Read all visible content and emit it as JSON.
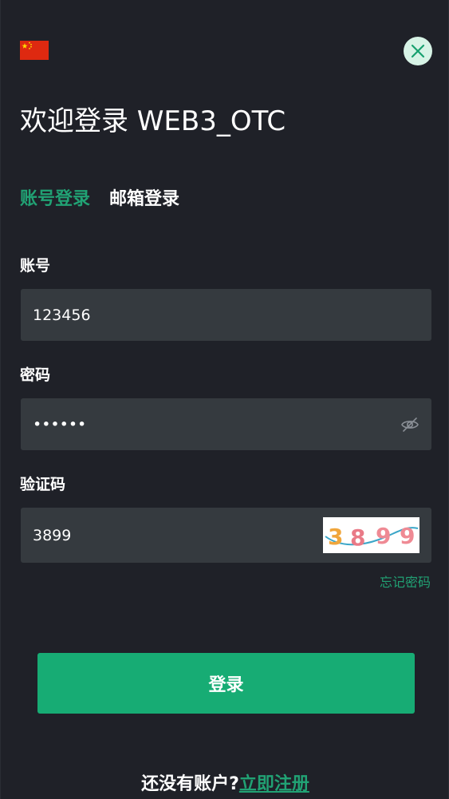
{
  "header": {
    "language_flag": "china-flag-icon",
    "close_icon": "close-icon"
  },
  "title": "欢迎登录 WEB3_OTC",
  "tabs": [
    {
      "label": "账号登录",
      "active": true
    },
    {
      "label": "邮箱登录",
      "active": false
    }
  ],
  "form": {
    "account": {
      "label": "账号",
      "value": "123456"
    },
    "password": {
      "label": "密码",
      "value": "••••••",
      "toggle_icon": "eye-slash-icon"
    },
    "captcha": {
      "label": "验证码",
      "value": "3899",
      "image_text": "3899"
    }
  },
  "forgot_password": "忘记密码",
  "login_button": "登录",
  "register": {
    "question": "还没有账户?",
    "link": "立即注册"
  },
  "colors": {
    "background": "#1f2128",
    "field": "#353a3f",
    "accent": "#21a274",
    "button": "#17ac74"
  }
}
